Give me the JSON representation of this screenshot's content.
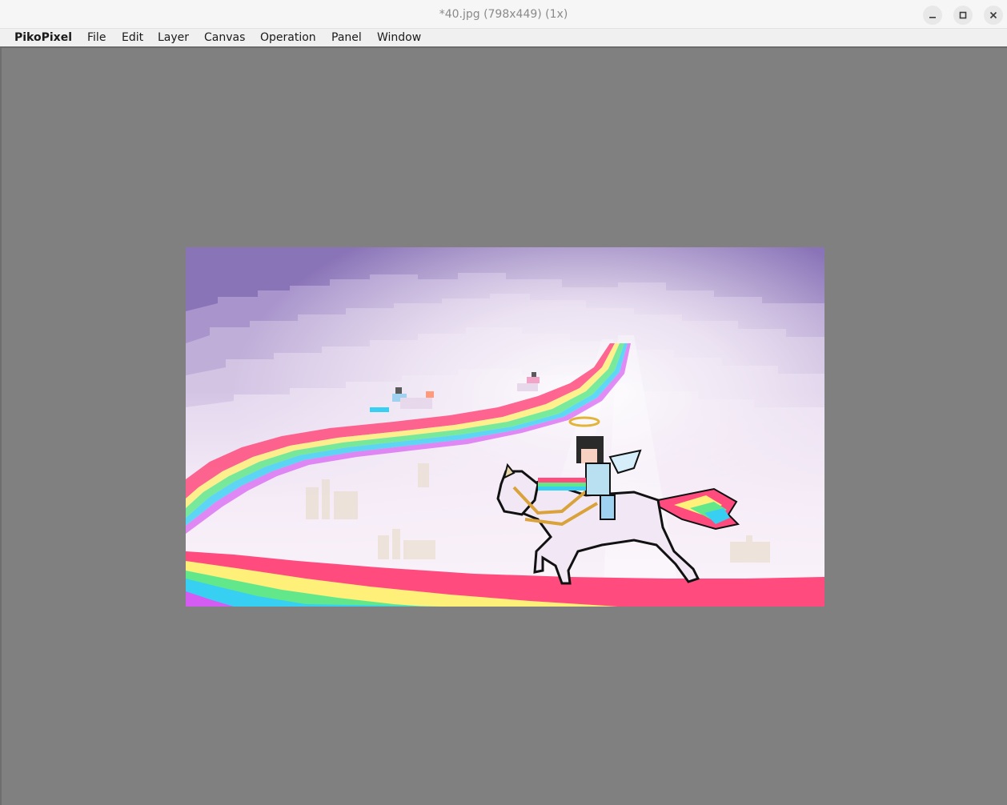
{
  "window": {
    "title": "*40.jpg (798x449) (1x)",
    "controls": {
      "minimize_icon": "minimize-icon",
      "maximize_icon": "maximize-icon",
      "close_icon": "close-icon"
    }
  },
  "menubar": {
    "app_name": "PikoPixel",
    "items": [
      "File",
      "Edit",
      "Layer",
      "Canvas",
      "Operation",
      "Panel",
      "Window"
    ]
  },
  "canvas": {
    "filename": "40.jpg",
    "image_width": 798,
    "image_height": 449,
    "zoom": "1x",
    "background_color": "#808080"
  },
  "colors": {
    "sky": "#8a74b8",
    "cloud_light": "#f3eaf6",
    "rainbow_red": "#ff4b7d",
    "rainbow_yellow": "#fff07a",
    "rainbow_green": "#62e88a",
    "rainbow_blue": "#37d0f2",
    "rainbow_purple": "#d55cf2"
  }
}
